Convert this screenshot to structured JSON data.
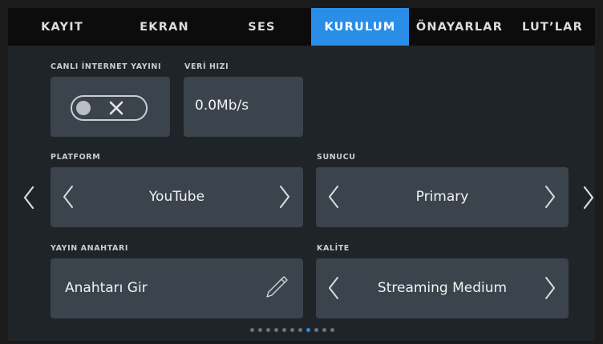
{
  "tabs": [
    {
      "label": "KAYIT",
      "active": false
    },
    {
      "label": "EKRAN",
      "active": false
    },
    {
      "label": "SES",
      "active": false
    },
    {
      "label": "KURULUM",
      "active": true
    },
    {
      "label": "ÖNAYARLAR",
      "active": false
    },
    {
      "label": "LUT’LAR",
      "active": false
    }
  ],
  "live_stream": {
    "label": "CANLI İNTERNET YAYINI",
    "enabled": false,
    "icon": "close-icon"
  },
  "bitrate": {
    "label": "VERİ HIZI",
    "value": "0.0Mb/s"
  },
  "platform": {
    "label": "PLATFORM",
    "value": "YouTube"
  },
  "server": {
    "label": "SUNUCU",
    "value": "Primary"
  },
  "stream_key": {
    "label": "YAYIN ANAHTARI",
    "value": "Anahtarı Gir",
    "icon": "pencil-icon"
  },
  "quality": {
    "label": "KALİTE",
    "value": "Streaming Medium"
  },
  "pagination": {
    "count": 11,
    "active_index": 7
  },
  "colors": {
    "accent": "#2a8ee8",
    "card": "#3b444c",
    "background": "#1f2428",
    "tabbar": "#0c0c0c"
  }
}
